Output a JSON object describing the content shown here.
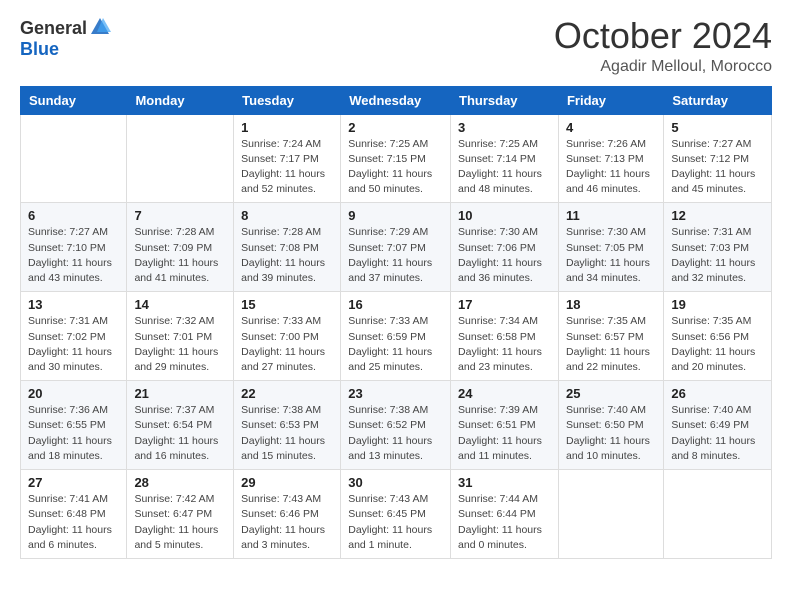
{
  "header": {
    "logo_general": "General",
    "logo_blue": "Blue",
    "month_title": "October 2024",
    "location": "Agadir Melloul, Morocco"
  },
  "days_of_week": [
    "Sunday",
    "Monday",
    "Tuesday",
    "Wednesday",
    "Thursday",
    "Friday",
    "Saturday"
  ],
  "weeks": [
    [
      {
        "num": "",
        "detail": ""
      },
      {
        "num": "",
        "detail": ""
      },
      {
        "num": "1",
        "detail": "Sunrise: 7:24 AM\nSunset: 7:17 PM\nDaylight: 11 hours and 52 minutes."
      },
      {
        "num": "2",
        "detail": "Sunrise: 7:25 AM\nSunset: 7:15 PM\nDaylight: 11 hours and 50 minutes."
      },
      {
        "num": "3",
        "detail": "Sunrise: 7:25 AM\nSunset: 7:14 PM\nDaylight: 11 hours and 48 minutes."
      },
      {
        "num": "4",
        "detail": "Sunrise: 7:26 AM\nSunset: 7:13 PM\nDaylight: 11 hours and 46 minutes."
      },
      {
        "num": "5",
        "detail": "Sunrise: 7:27 AM\nSunset: 7:12 PM\nDaylight: 11 hours and 45 minutes."
      }
    ],
    [
      {
        "num": "6",
        "detail": "Sunrise: 7:27 AM\nSunset: 7:10 PM\nDaylight: 11 hours and 43 minutes."
      },
      {
        "num": "7",
        "detail": "Sunrise: 7:28 AM\nSunset: 7:09 PM\nDaylight: 11 hours and 41 minutes."
      },
      {
        "num": "8",
        "detail": "Sunrise: 7:28 AM\nSunset: 7:08 PM\nDaylight: 11 hours and 39 minutes."
      },
      {
        "num": "9",
        "detail": "Sunrise: 7:29 AM\nSunset: 7:07 PM\nDaylight: 11 hours and 37 minutes."
      },
      {
        "num": "10",
        "detail": "Sunrise: 7:30 AM\nSunset: 7:06 PM\nDaylight: 11 hours and 36 minutes."
      },
      {
        "num": "11",
        "detail": "Sunrise: 7:30 AM\nSunset: 7:05 PM\nDaylight: 11 hours and 34 minutes."
      },
      {
        "num": "12",
        "detail": "Sunrise: 7:31 AM\nSunset: 7:03 PM\nDaylight: 11 hours and 32 minutes."
      }
    ],
    [
      {
        "num": "13",
        "detail": "Sunrise: 7:31 AM\nSunset: 7:02 PM\nDaylight: 11 hours and 30 minutes."
      },
      {
        "num": "14",
        "detail": "Sunrise: 7:32 AM\nSunset: 7:01 PM\nDaylight: 11 hours and 29 minutes."
      },
      {
        "num": "15",
        "detail": "Sunrise: 7:33 AM\nSunset: 7:00 PM\nDaylight: 11 hours and 27 minutes."
      },
      {
        "num": "16",
        "detail": "Sunrise: 7:33 AM\nSunset: 6:59 PM\nDaylight: 11 hours and 25 minutes."
      },
      {
        "num": "17",
        "detail": "Sunrise: 7:34 AM\nSunset: 6:58 PM\nDaylight: 11 hours and 23 minutes."
      },
      {
        "num": "18",
        "detail": "Sunrise: 7:35 AM\nSunset: 6:57 PM\nDaylight: 11 hours and 22 minutes."
      },
      {
        "num": "19",
        "detail": "Sunrise: 7:35 AM\nSunset: 6:56 PM\nDaylight: 11 hours and 20 minutes."
      }
    ],
    [
      {
        "num": "20",
        "detail": "Sunrise: 7:36 AM\nSunset: 6:55 PM\nDaylight: 11 hours and 18 minutes."
      },
      {
        "num": "21",
        "detail": "Sunrise: 7:37 AM\nSunset: 6:54 PM\nDaylight: 11 hours and 16 minutes."
      },
      {
        "num": "22",
        "detail": "Sunrise: 7:38 AM\nSunset: 6:53 PM\nDaylight: 11 hours and 15 minutes."
      },
      {
        "num": "23",
        "detail": "Sunrise: 7:38 AM\nSunset: 6:52 PM\nDaylight: 11 hours and 13 minutes."
      },
      {
        "num": "24",
        "detail": "Sunrise: 7:39 AM\nSunset: 6:51 PM\nDaylight: 11 hours and 11 minutes."
      },
      {
        "num": "25",
        "detail": "Sunrise: 7:40 AM\nSunset: 6:50 PM\nDaylight: 11 hours and 10 minutes."
      },
      {
        "num": "26",
        "detail": "Sunrise: 7:40 AM\nSunset: 6:49 PM\nDaylight: 11 hours and 8 minutes."
      }
    ],
    [
      {
        "num": "27",
        "detail": "Sunrise: 7:41 AM\nSunset: 6:48 PM\nDaylight: 11 hours and 6 minutes."
      },
      {
        "num": "28",
        "detail": "Sunrise: 7:42 AM\nSunset: 6:47 PM\nDaylight: 11 hours and 5 minutes."
      },
      {
        "num": "29",
        "detail": "Sunrise: 7:43 AM\nSunset: 6:46 PM\nDaylight: 11 hours and 3 minutes."
      },
      {
        "num": "30",
        "detail": "Sunrise: 7:43 AM\nSunset: 6:45 PM\nDaylight: 11 hours and 1 minute."
      },
      {
        "num": "31",
        "detail": "Sunrise: 7:44 AM\nSunset: 6:44 PM\nDaylight: 11 hours and 0 minutes."
      },
      {
        "num": "",
        "detail": ""
      },
      {
        "num": "",
        "detail": ""
      }
    ]
  ]
}
